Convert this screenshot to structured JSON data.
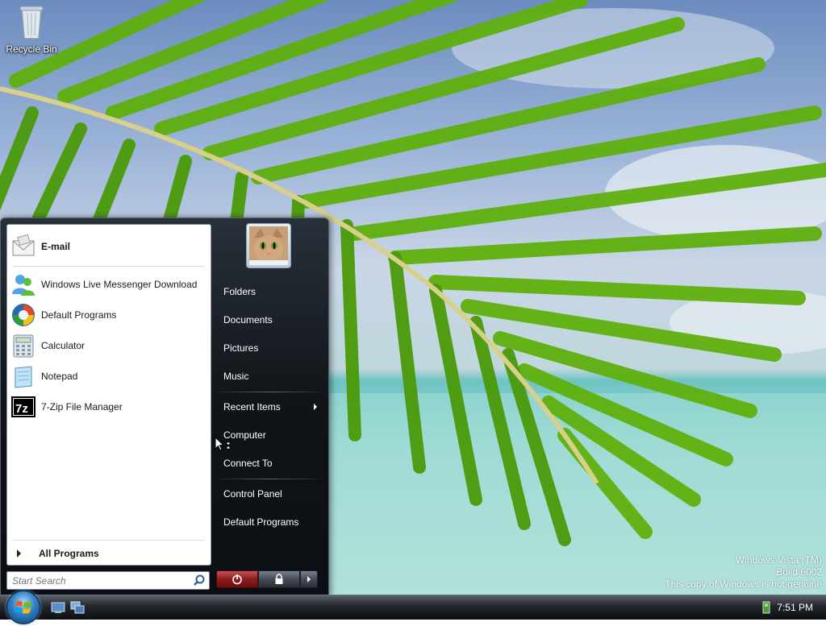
{
  "desktop": {
    "recycle_bin_label": "Recycle Bin",
    "watermark": {
      "line1": "Windows Vista (TM)",
      "line2": "Build 6002",
      "line3": "This copy of Windows is not genuine"
    }
  },
  "start_menu": {
    "pinned": [
      {
        "label": "E-mail",
        "icon": "email-icon"
      }
    ],
    "recent": [
      {
        "label": "Windows Live Messenger Download",
        "icon": "messenger-icon"
      },
      {
        "label": "Default Programs",
        "icon": "default-programs-icon"
      },
      {
        "label": "Calculator",
        "icon": "calculator-icon"
      },
      {
        "label": "Notepad",
        "icon": "notepad-icon"
      },
      {
        "label": "7-Zip File Manager",
        "icon": "7zip-icon"
      }
    ],
    "all_programs_label": "All Programs",
    "search_placeholder": "Start Search",
    "right_items": {
      "folders": "Folders",
      "documents": "Documents",
      "pictures": "Pictures",
      "music": "Music",
      "recent_items": "Recent Items",
      "computer": "Computer",
      "connect_to": "Connect To",
      "control_panel": "Control Panel",
      "default_programs": "Default Programs"
    }
  },
  "taskbar": {
    "clock": "7:51 PM"
  },
  "colors": {
    "power_button": "#8e1c1c",
    "menu_background": "#101418",
    "accent": "#2e7fc4"
  }
}
